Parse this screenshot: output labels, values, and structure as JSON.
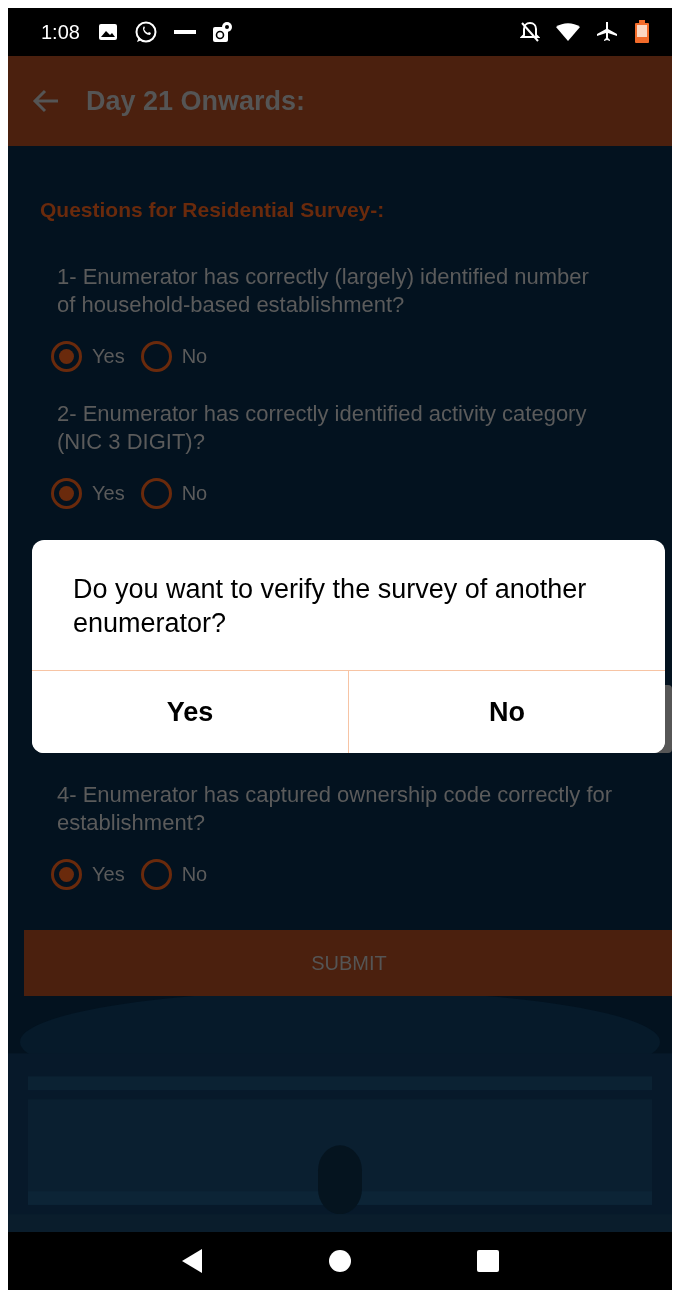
{
  "status_bar": {
    "time": "1:08"
  },
  "app_bar": {
    "title": "Day 21 Onwards:"
  },
  "section_title": "Questions for Residential Survey-:",
  "questions": [
    {
      "text": "1- Enumerator has correctly (largely) identified number of household-based establishment?",
      "options": [
        {
          "label": "Yes",
          "selected": true
        },
        {
          "label": "No",
          "selected": false
        }
      ]
    },
    {
      "text": "2- Enumerator has correctly identified activity category (NIC 3 DIGIT)?",
      "options": [
        {
          "label": "Yes",
          "selected": true
        },
        {
          "label": "No",
          "selected": false
        }
      ]
    },
    {
      "kind": "hidden"
    },
    {
      "text": "4- Enumerator has captured ownership code correctly for establishment?",
      "options": [
        {
          "label": "Yes",
          "selected": true
        },
        {
          "label": "No",
          "selected": false
        }
      ]
    }
  ],
  "submit_button": "SUBMIT",
  "dialog": {
    "message": "Do you want to verify the survey of another enumerator?",
    "buttons": [
      "Yes",
      "No"
    ]
  }
}
